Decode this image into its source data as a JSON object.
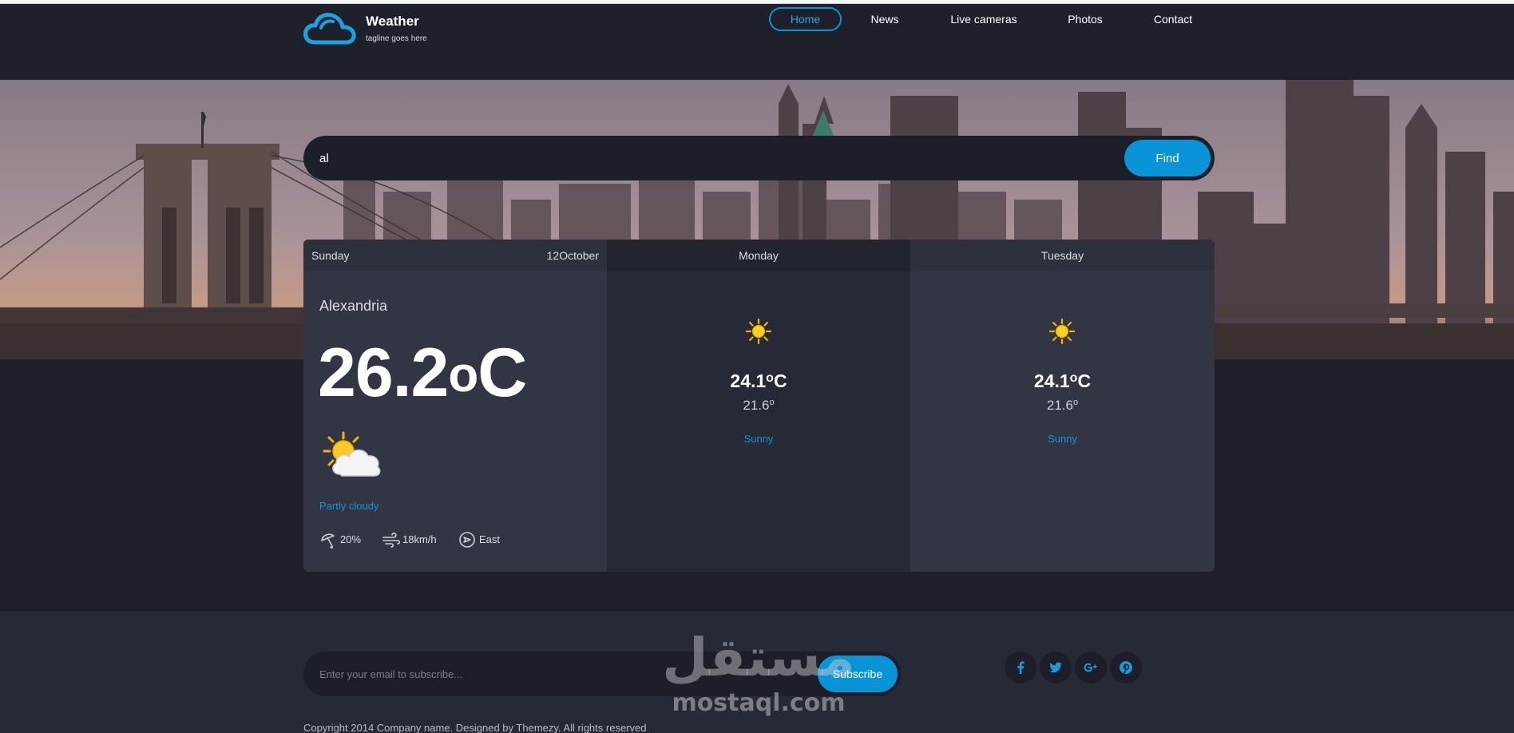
{
  "brand": {
    "title": "Weather",
    "tagline": "tagline goes here"
  },
  "nav": {
    "items": [
      {
        "label": "Home",
        "active": true
      },
      {
        "label": "News",
        "active": false
      },
      {
        "label": "Live cameras",
        "active": false
      },
      {
        "label": "Photos",
        "active": false
      },
      {
        "label": "Contact",
        "active": false
      }
    ]
  },
  "search": {
    "value": "al",
    "button_label": "Find"
  },
  "forecast": {
    "today": {
      "day": "Sunday",
      "date": "12October",
      "location": "Alexandria",
      "temp_value": "26.2",
      "temp_degree": "o",
      "temp_unit": "C",
      "icon": "partly-cloudy-icon",
      "condition": "Partly cloudy",
      "rain": "20%",
      "wind_speed": "18km/h",
      "wind_direction": "East"
    },
    "days": [
      {
        "day": "Monday",
        "icon": "sun-icon",
        "high_value": "24.1",
        "high_degree": "o",
        "high_unit": "C",
        "low_value": "21.6",
        "low_degree": "o",
        "condition": "Sunny"
      },
      {
        "day": "Tuesday",
        "icon": "sun-icon",
        "high_value": "24.1",
        "high_degree": "o",
        "high_unit": "C",
        "low_value": "21.6",
        "low_degree": "o",
        "condition": "Sunny"
      }
    ]
  },
  "footer": {
    "subscribe_placeholder": "Enter your email to subscribe...",
    "subscribe_button": "Subscribe",
    "social": [
      "facebook-icon",
      "twitter-icon",
      "google-plus-icon",
      "pinterest-icon"
    ],
    "copyright": "Copyright 2014 Company name. Designed by Themezy. All rights reserved"
  },
  "watermark": {
    "arabic": "مستقل",
    "latin": "mostaql.com"
  },
  "colors": {
    "accent": "#0a94d8",
    "background": "#1e202b",
    "panel": "#323544",
    "panel_alt": "#262936"
  }
}
